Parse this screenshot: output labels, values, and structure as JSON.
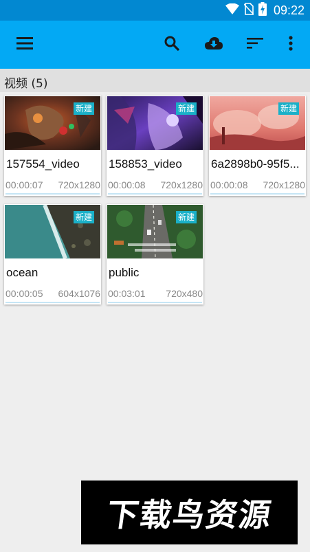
{
  "status_bar": {
    "time": "09:22"
  },
  "app_bar": {
    "icons": [
      "menu-icon",
      "search-icon",
      "cloud-download-icon",
      "sort-icon",
      "more-vert-icon"
    ]
  },
  "section": {
    "title": "视频 (5)"
  },
  "videos": [
    {
      "name": "157554_video",
      "duration": "00:00:07",
      "resolution": "720x1280",
      "badge": "新建"
    },
    {
      "name": "158853_video",
      "duration": "00:00:08",
      "resolution": "720x1280",
      "badge": "新建"
    },
    {
      "name": "6a2898b0-95f5...",
      "duration": "00:00:08",
      "resolution": "720x1280",
      "badge": "新建"
    },
    {
      "name": "ocean",
      "duration": "00:00:05",
      "resolution": "604x1076",
      "badge": "新建"
    },
    {
      "name": "public",
      "duration": "00:03:01",
      "resolution": "720x480",
      "badge": "新建"
    }
  ],
  "watermark": {
    "text": "下载鸟资源"
  },
  "colors": {
    "status_bar": "#0288d1",
    "app_bar": "#03a9f4",
    "badge": "#1ab0c8",
    "background": "#eeeeee"
  }
}
